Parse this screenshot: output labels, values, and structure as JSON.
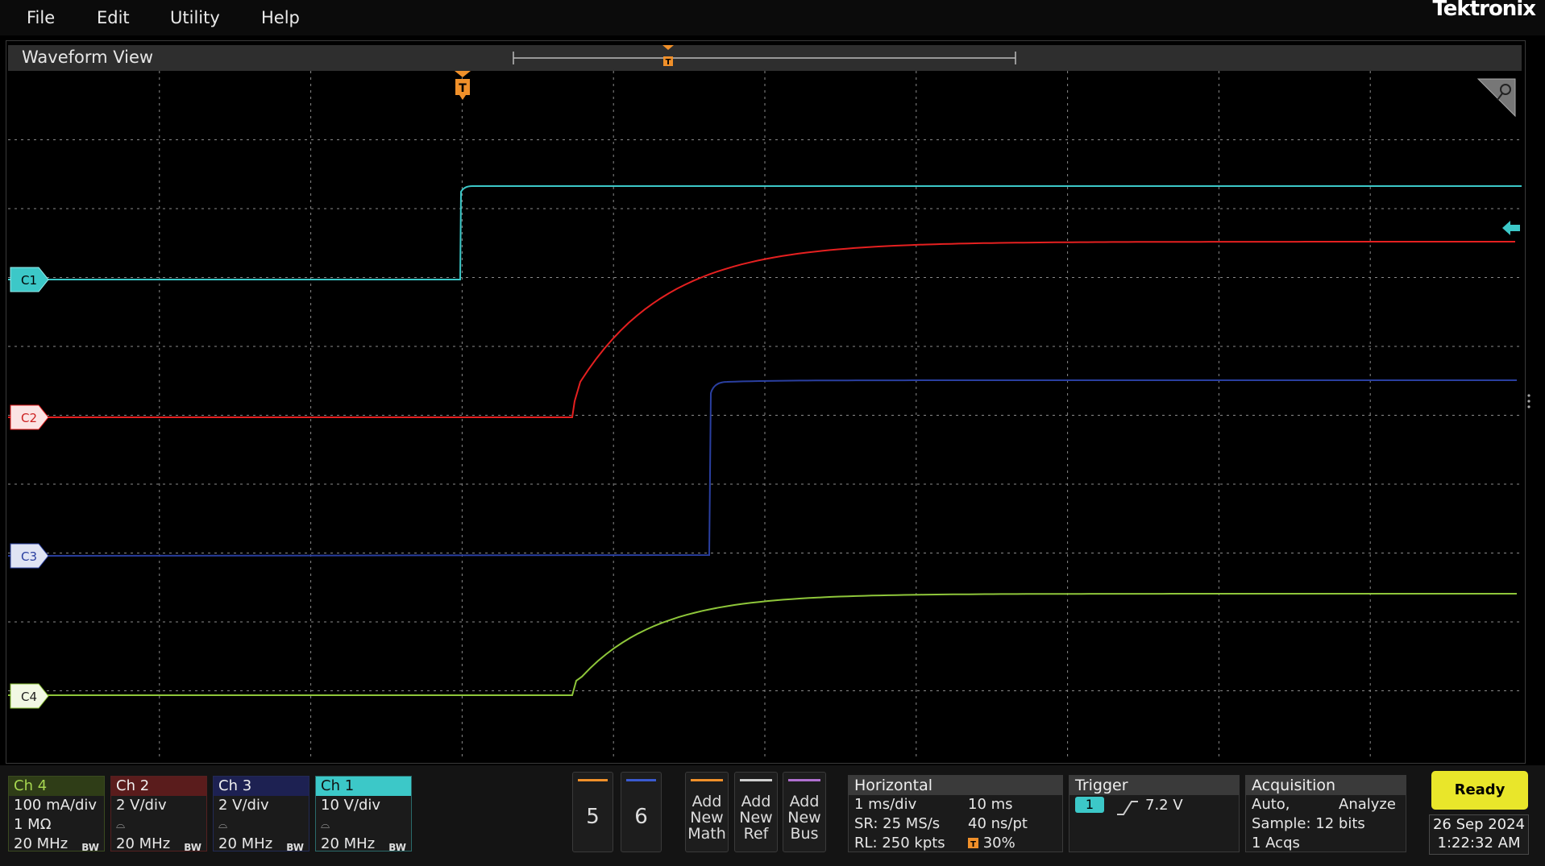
{
  "menu": {
    "items": [
      "File",
      "Edit",
      "Utility",
      "Help"
    ],
    "brand": "Tektronix"
  },
  "waveform_view": {
    "title": "Waveform View",
    "trigger_marker": "T"
  },
  "channel_labels": [
    "C1",
    "C2",
    "C3",
    "C4"
  ],
  "colors": {
    "ch1": "#3cc8c8",
    "ch2": "#e52020",
    "ch3": "#2a3fa0",
    "ch4": "#8ec63a",
    "trigger": "#f0902a",
    "ready": "#e9e62a"
  },
  "badges": [
    {
      "name": "Ch 4",
      "line1": "100 mA/div",
      "line2": "1 MΩ",
      "line3": "20 MHz",
      "bw": "BW"
    },
    {
      "name": "Ch 2",
      "line1": "2 V/div",
      "line2": "⌓",
      "line3": "20 MHz",
      "bw": "BW"
    },
    {
      "name": "Ch 3",
      "line1": "2 V/div",
      "line2": "⌓",
      "line3": "20 MHz",
      "bw": "BW"
    },
    {
      "name": "Ch 1",
      "line1": "10 V/div",
      "line2": "⌓",
      "line3": "20 MHz",
      "bw": "BW"
    }
  ],
  "ref_buttons": [
    "5",
    "6"
  ],
  "add_buttons": [
    {
      "label": "Add New Math"
    },
    {
      "label": "Add New Ref"
    },
    {
      "label": "Add New Bus"
    }
  ],
  "horizontal": {
    "title": "Horizontal",
    "scale": "1 ms/div",
    "record": "10 ms",
    "sr": "SR: 25 MS/s",
    "pt": "40 ns/pt",
    "rl": "RL: 250 kpts",
    "position": "30%"
  },
  "trigger": {
    "title": "Trigger",
    "channel": "1",
    "level": "7.2 V"
  },
  "acquisition": {
    "title": "Acquisition",
    "mode": "Auto,",
    "action": "Analyze",
    "sample": "Sample: 12 bits",
    "acqs": "1 Acqs"
  },
  "status": {
    "ready": "Ready",
    "date": "26 Sep 2024",
    "time": "1:22:32 AM"
  }
}
